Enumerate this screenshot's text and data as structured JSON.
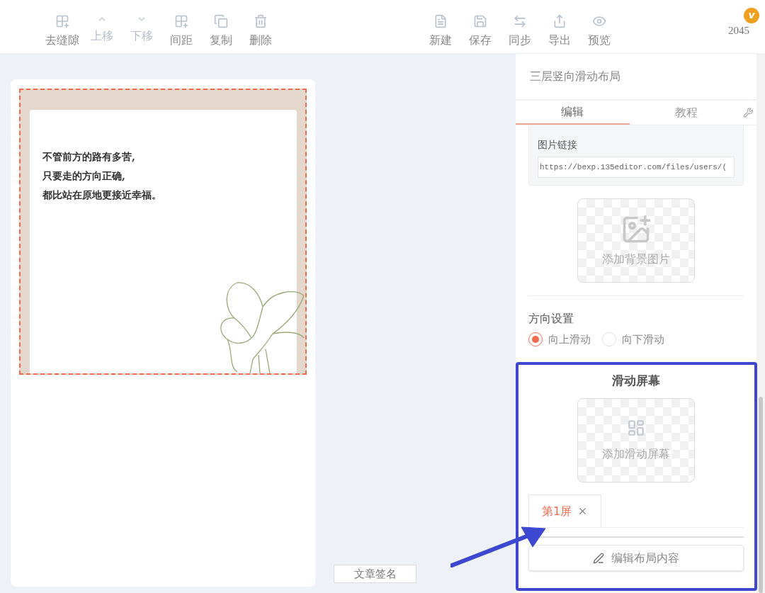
{
  "toolbar_left": [
    {
      "kind": "gap",
      "label": "去缝隙",
      "disabled": false
    },
    {
      "kind": "up",
      "label": "上移",
      "disabled": true
    },
    {
      "kind": "down",
      "label": "下移",
      "disabled": true
    },
    {
      "kind": "gap",
      "label": "间距",
      "disabled": false
    },
    {
      "kind": "copy",
      "label": "复制",
      "disabled": false
    },
    {
      "kind": "delete",
      "label": "删除",
      "disabled": false
    }
  ],
  "toolbar_right": [
    {
      "kind": "new",
      "label": "新建",
      "disabled": false
    },
    {
      "kind": "save",
      "label": "保存",
      "disabled": false
    },
    {
      "kind": "sync",
      "label": "同步",
      "disabled": false
    },
    {
      "kind": "export",
      "label": "导出",
      "disabled": false
    },
    {
      "kind": "preview",
      "label": "预览",
      "disabled": false
    }
  ],
  "user": {
    "badge": "v",
    "count": "2045"
  },
  "canvas": {
    "lines": [
      "不管前方的路有多苦,",
      "只要走的方向正确,",
      "都比站在原地更接近幸福。"
    ],
    "signature_button": "文章签名"
  },
  "panel": {
    "title": "三层竖向滑动布局",
    "tabs": [
      {
        "label": "编辑",
        "selected": true
      },
      {
        "label": "教程",
        "selected": false
      }
    ],
    "image_link": {
      "label": "图片链接",
      "value": "https://bexp.135editor.com/files/users/("
    },
    "add_background": "添加背景图片",
    "direction": {
      "label": "方向设置",
      "options": [
        {
          "label": "向上滑动",
          "selected": true
        },
        {
          "label": "向下滑动",
          "selected": false
        }
      ]
    },
    "screens": {
      "title": "滑动屏幕",
      "add": "添加滑动屏幕",
      "tabs": [
        {
          "label": "第1屏",
          "selected": true
        }
      ],
      "edit_button": "编辑布局内容"
    }
  }
}
